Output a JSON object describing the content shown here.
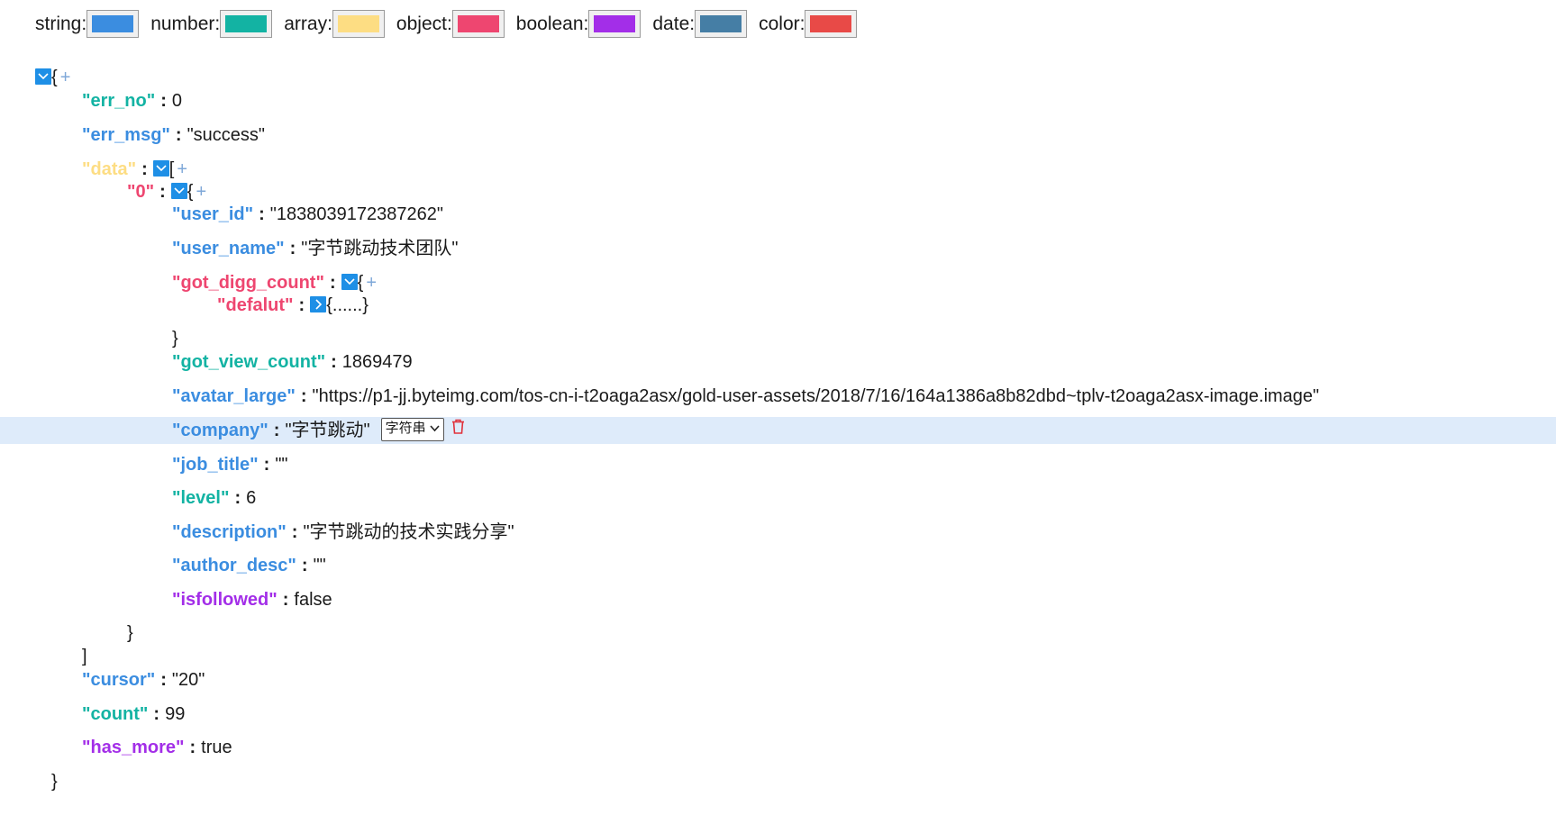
{
  "legend": [
    {
      "label": "string:",
      "color": "#3b8de0"
    },
    {
      "label": "number:",
      "color": "#13b3a3"
    },
    {
      "label": "array:",
      "color": "#fddd83"
    },
    {
      "label": "object:",
      "color": "#ee4670"
    },
    {
      "label": "boolean:",
      "color": "#a32ee8"
    },
    {
      "label": "date:",
      "color": "#457ea5"
    },
    {
      "label": "color:",
      "color": "#e84a47"
    }
  ],
  "colors": {
    "string": "#3b8de0",
    "number": "#13b3a3",
    "array": "#fddd83",
    "object": "#ee4670",
    "boolean": "#a32ee8"
  },
  "tree": {
    "root_open": "{",
    "root_close": "}",
    "err_no": {
      "key": "\"err_no\"",
      "value": "0"
    },
    "err_msg": {
      "key": "\"err_msg\"",
      "value": "\"success\""
    },
    "data": {
      "key": "\"data\"",
      "open": "[",
      "close": "]"
    },
    "item0": {
      "key": "\"0\"",
      "open": "{",
      "close": "}"
    },
    "user_id": {
      "key": "\"user_id\"",
      "value": "\"1838039172387262\""
    },
    "user_name": {
      "key": "\"user_name\"",
      "value": "\"字节跳动技术团队\""
    },
    "got_digg_count": {
      "key": "\"got_digg_count\"",
      "open": "{",
      "close": "}"
    },
    "defalut": {
      "key": "\"defalut\"",
      "collapsed": "{......}"
    },
    "got_view_count": {
      "key": "\"got_view_count\"",
      "value": "1869479"
    },
    "avatar_large": {
      "key": "\"avatar_large\"",
      "value": "\"https://p1-jj.byteimg.com/tos-cn-i-t2oaga2asx/gold-user-assets/2018/7/16/164a1386a8b82dbd~tplv-t2oaga2asx-image.image\""
    },
    "company": {
      "key": "\"company\"",
      "value": "\"字节跳动\"",
      "type_select": "字符串"
    },
    "job_title": {
      "key": "\"job_title\"",
      "value": "\"\""
    },
    "level": {
      "key": "\"level\"",
      "value": "6"
    },
    "description": {
      "key": "\"description\"",
      "value": "\"字节跳动的技术实践分享\""
    },
    "author_desc": {
      "key": "\"author_desc\"",
      "value": "\"\""
    },
    "isfollowed": {
      "key": "\"isfollowed\"",
      "value": "false"
    },
    "cursor": {
      "key": "\"cursor\"",
      "value": "\"20\""
    },
    "count": {
      "key": "\"count\"",
      "value": "99"
    },
    "has_more": {
      "key": "\"has_more\"",
      "value": "true"
    }
  },
  "separator": ":",
  "plus": "+"
}
